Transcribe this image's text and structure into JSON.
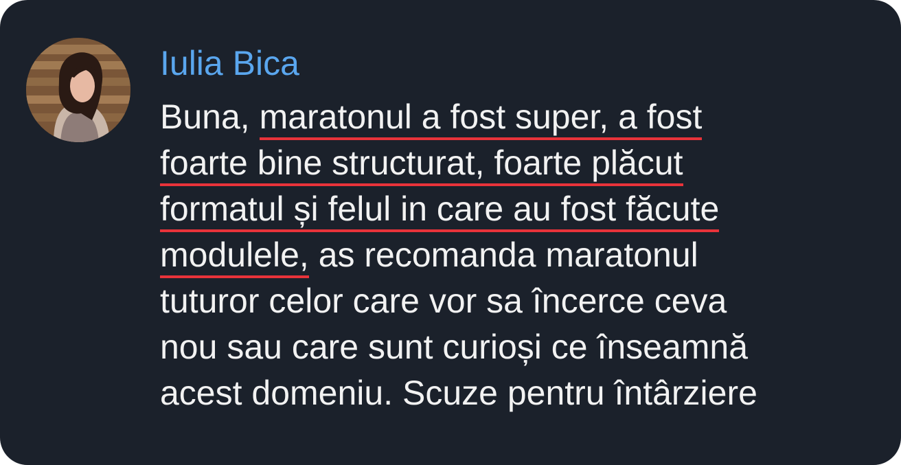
{
  "message": {
    "sender_name": "Iulia Bica",
    "avatar_icon": "user-photo-avatar",
    "highlight_color": "#e8333a",
    "sender_color": "#5aa6ee",
    "lines": [
      {
        "plain": "Buna, ",
        "highlight": "maratonul a fost super, a fost",
        "rest": ""
      },
      {
        "plain": "",
        "highlight": "foarte bine structurat, foarte plăcut",
        "rest": ""
      },
      {
        "plain": "",
        "highlight": "formatul și felul in care au fost făcute",
        "rest": ""
      },
      {
        "plain": "",
        "highlight": "modulele,",
        "rest": " as recomanda maratonul"
      },
      {
        "plain": "tuturor celor care vor sa încerce ceva",
        "highlight": "",
        "rest": ""
      },
      {
        "plain": "nou sau care sunt curioși ce înseamnă",
        "highlight": "",
        "rest": ""
      },
      {
        "plain": "acest domeniu. Scuze pentru întârziere",
        "highlight": "",
        "rest": ""
      }
    ]
  }
}
